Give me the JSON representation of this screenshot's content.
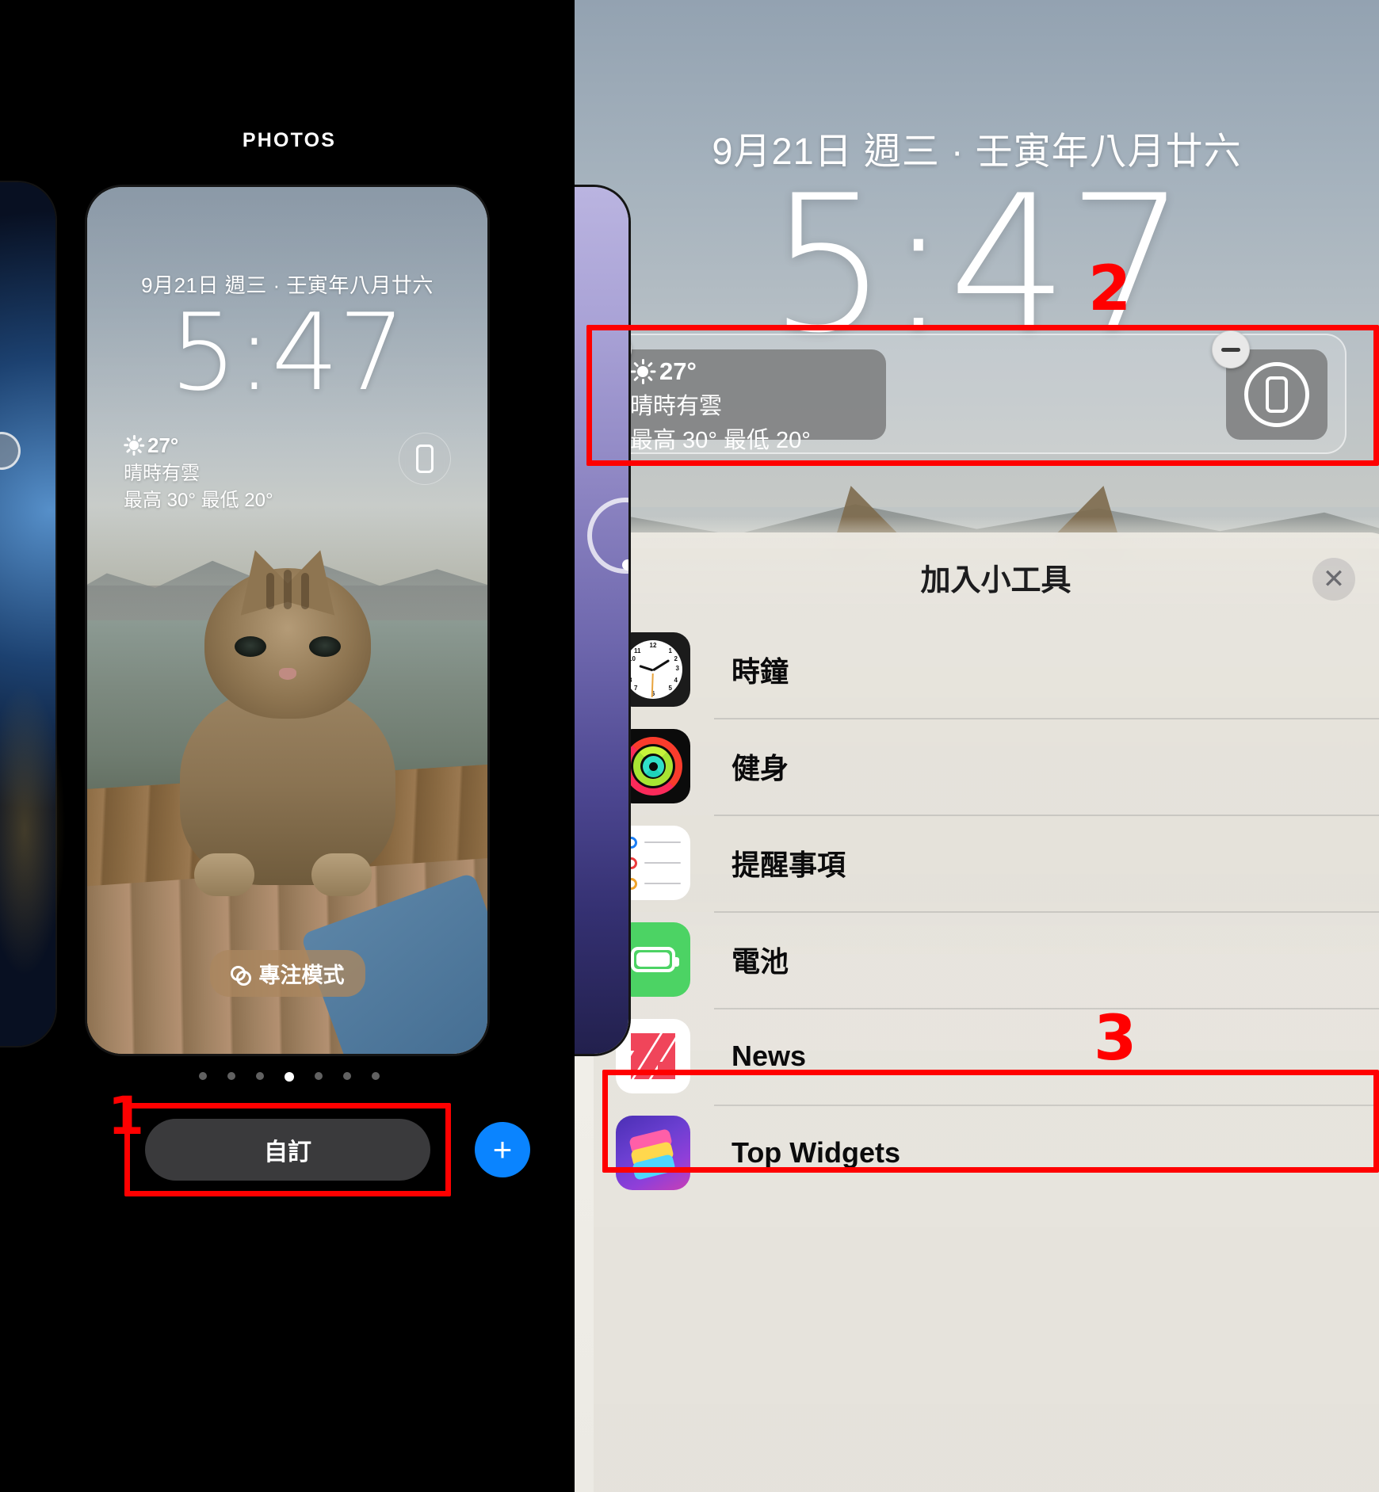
{
  "left_screen": {
    "section_label": "PHOTOS",
    "lock_screen": {
      "date": "9月21日 週三 · 壬寅年八月廿六",
      "time": "5:47",
      "weather": {
        "temperature": "27°",
        "condition": "晴時有雲",
        "high_low": "最高 30° 最低 20°",
        "icon": "sun-icon"
      },
      "device_widget_icon": "iphone-icon",
      "focus_pill_label": "專注模式",
      "focus_pill_icon": "link-icon"
    },
    "page_dots": {
      "total": 7,
      "active_index": 3
    },
    "customise_button_label": "自訂",
    "add_button_label": "+"
  },
  "right_screen": {
    "lock_screen": {
      "date": "9月21日 週三 · 壬寅年八月廿六",
      "time": "5:47"
    },
    "widget_tray": {
      "weather_widget": {
        "temperature": "27°",
        "condition": "晴時有雲",
        "high_low": "最高 30° 最低 20°",
        "icon": "sun-icon",
        "remove_badge_icon": "minus-icon"
      },
      "device_widget": {
        "icon": "iphone-in-circle-icon",
        "remove_badge_icon": "minus-icon"
      }
    },
    "add_widget_sheet": {
      "title": "加入小工具",
      "close_icon": "close-icon",
      "items": [
        {
          "label": "時鐘",
          "icon": "clock-app-icon"
        },
        {
          "label": "健身",
          "icon": "fitness-app-icon"
        },
        {
          "label": "提醒事項",
          "icon": "reminders-app-icon"
        },
        {
          "label": "電池",
          "icon": "battery-app-icon"
        },
        {
          "label": "News",
          "icon": "news-app-icon"
        },
        {
          "label": "Top Widgets",
          "icon": "top-widgets-app-icon"
        }
      ]
    }
  },
  "annotations": {
    "marker_1": "1",
    "marker_2": "2",
    "marker_3": "3",
    "color": "#ff0000"
  }
}
